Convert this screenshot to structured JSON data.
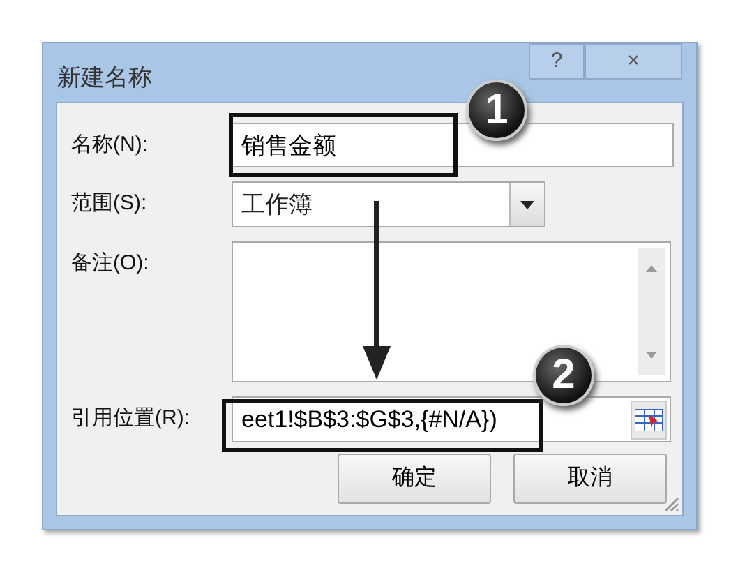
{
  "window": {
    "title": "新建名称",
    "help_button": "?",
    "close_button": "×"
  },
  "fields": [
    {
      "kind": "text",
      "label": "名称(N):",
      "value": "销售金额"
    },
    {
      "kind": "select",
      "label": "范围(S):",
      "value": "工作簿"
    },
    {
      "kind": "textarea",
      "label": "备注(O):"
    },
    {
      "kind": "reference",
      "label": "引用位置(R):",
      "value": "eet1!$B$3:$G$3,{#N/A})"
    }
  ],
  "buttons": [
    "确定",
    "取消"
  ],
  "callouts": [
    {
      "number": "1"
    },
    {
      "number": "2"
    }
  ]
}
